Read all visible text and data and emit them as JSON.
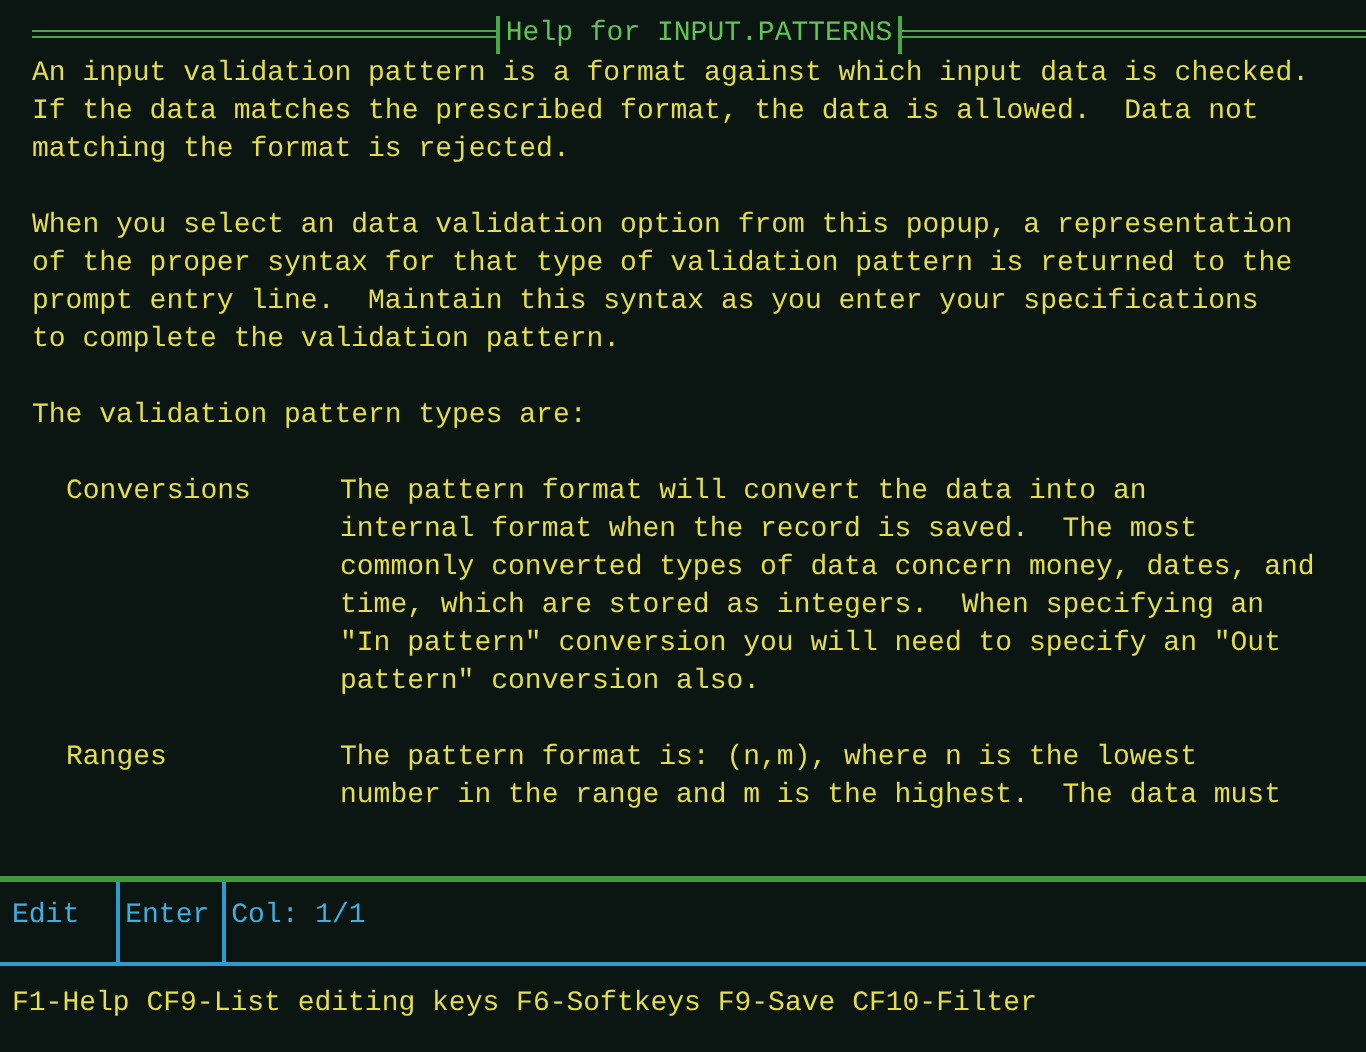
{
  "window": {
    "title": "Help for INPUT.PATTERNS"
  },
  "paragraphs": [
    "An input validation pattern is a format against which input data is checked.\nIf the data matches the prescribed format, the data is allowed.  Data not\nmatching the format is rejected.",
    "When you select an data validation option from this popup, a representation\nof the proper syntax for that type of validation pattern is returned to the\nprompt entry line.  Maintain this syntax as you enter your specifications\nto complete the validation pattern.",
    "The validation pattern types are:"
  ],
  "definitions": [
    {
      "term": "Conversions",
      "description": "The pattern format will convert the data into an\ninternal format when the record is saved.  The most\ncommonly converted types of data concern money, dates, and\ntime, which are stored as integers.  When specifying an\n\"In pattern\" conversion you will need to specify an \"Out\npattern\" conversion also."
    },
    {
      "term": "Ranges",
      "description": "The pattern format is: (n,m), where n is the lowest\nnumber in the range and m is the highest.  The data must"
    }
  ],
  "status_bar": [
    "Edit",
    "Enter",
    "Col: 1/1"
  ],
  "function_keys": "F1-Help CF9-List editing keys F6-Softkeys F9-Save CF10-Filter"
}
